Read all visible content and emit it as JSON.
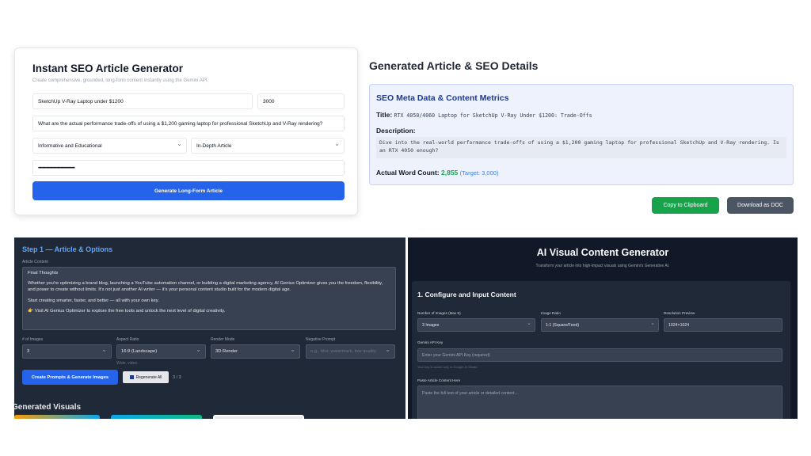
{
  "seo_card": {
    "title": "Instant SEO Article Generator",
    "subtitle": "Create comprehensive, grounded, long-form content instantly using the Gemini API.",
    "keyword_value": "SketchUp V-Ray Laptop under $1200",
    "word_count_value": "3000",
    "question_value": "What are the actual performance trade-offs of using a $1,200 gaming laptop for professional SketchUp and V-Ray rendering?",
    "tone_value": "Informative and Educational",
    "length_value": "In-Depth Article",
    "api_key_value": "••••••••••••••••••••••••••••••••••••",
    "generate_label": "Generate Long-Form Article"
  },
  "results": {
    "title": "Generated Article & SEO Details",
    "meta_heading": "SEO Meta Data & Content Metrics",
    "title_label": "Title:",
    "title_value": "RTX 4050/4060 Laptop for SketchUp V-Ray Under $1200: Trade-Offs",
    "desc_label": "Description:",
    "desc_value": "Dive into the real-world performance trade-offs of using a $1,200 gaming laptop for professional SketchUp and V-Ray rendering. Is an RTX 4050 enough?",
    "wc_label": "Actual Word Count:",
    "wc_value": "2,855",
    "wc_target": "(Target: 3,000)",
    "copy_label": "Copy to Clipboard",
    "download_label": "Download as DOC"
  },
  "step1": {
    "heading": "Step 1 — Article & Options",
    "content_label": "Article Content",
    "para1": "Final Thoughts",
    "para2": "Whether you're optimizing a brand blog, launching a YouTube automation channel, or building a digital marketing agency, AI Genius Optimizer gives you the freedom, flexibility, and power to create without limits. It's not just another AI writer — it's your personal content studio built for the modern digital age.",
    "para3": "Start creating smarter, faster, and better — all with your own key.",
    "para4": "👉 Visit AI Genius Optimizer to explore the free tools and unlock the next level of digital creativity.",
    "num_images_label": "# of Images",
    "num_images_value": "3",
    "aspect_label": "Aspect Ratio",
    "aspect_value": "16:9 (Landscape)",
    "aspect_hint": "Wide, video",
    "render_label": "Render Mode",
    "render_value": "3D Render",
    "negative_label": "Negative Prompt",
    "negative_placeholder": "e.g., blur, watermark, low quality",
    "create_label": "Create Prompts & Generate Images",
    "regen_label": "Regenerate All",
    "regen_count": "3 / 3",
    "generated_title": "Generated Visuals"
  },
  "visual": {
    "title": "AI Visual Content Generator",
    "subtitle": "Transform your article into high-impact visuals using Gemini's Generative AI.",
    "section": "1. Configure and Input Content",
    "num_label": "Number of Images (Max 5)",
    "num_value": "3 Images",
    "ratio_label": "Image Ratio",
    "ratio_value": "1:1 (Square/Feed)",
    "res_label": "Resolution Preview",
    "res_value": "1024×1024",
    "api_label": "Gemini API Key",
    "api_placeholder": "Enter your Gemini API Key (required)",
    "api_hint": "Your key is stored only in Google AI Studio",
    "paste_label": "Paste Article Content Here",
    "paste_placeholder": "Paste the full text of your article or detailed content..."
  },
  "colors": {
    "primary_blue": "#2563eb",
    "success_green": "#16a34a",
    "dark_panel": "#1f2937"
  }
}
